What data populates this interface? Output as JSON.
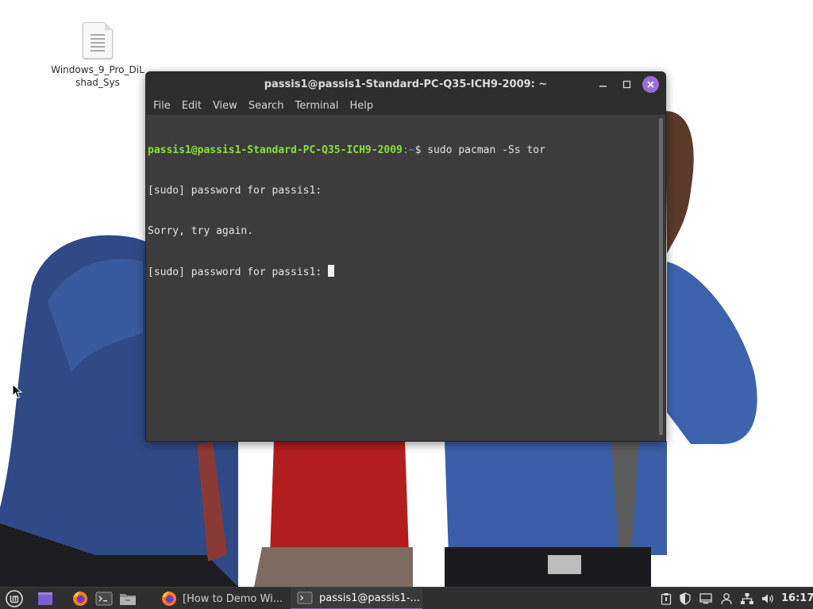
{
  "desktop": {
    "icons": [
      {
        "label": "Windows_9_Pro_DiLshad_Sys"
      }
    ]
  },
  "window": {
    "title": "passis1@passis1-Standard-PC-Q35-ICH9-2009: ~",
    "close_color": "#9b6bd9",
    "menu": [
      "File",
      "Edit",
      "View",
      "Search",
      "Terminal",
      "Help"
    ]
  },
  "terminal": {
    "prompt_user": "passis1@passis1-Standard-PC-Q35-ICH9-2009",
    "prompt_dir": ":~",
    "prompt_symbol": "$ ",
    "command": "sudo pacman -Ss tor",
    "output": [
      "[sudo] password for passis1:",
      "Sorry, try again.",
      "[sudo] password for passis1: "
    ],
    "prompt_user_color": "#8ae234",
    "prompt_dir_color": "#729fcf"
  },
  "taskbar": {
    "launchers": [
      "linux-mint-menu-icon",
      "show-desktop-icon",
      "firefox-icon",
      "terminal-icon",
      "files-icon"
    ],
    "tasks": [
      {
        "label": "[How to Demo Wi...",
        "icon": "firefox-icon",
        "active": false
      },
      {
        "label": "passis1@passis1-...",
        "icon": "terminal-icon",
        "active": true
      }
    ],
    "tray": [
      "clipboard-icon",
      "shield-icon",
      "display-icon",
      "user-icon",
      "network-icon",
      "volume-icon"
    ],
    "clock": "16:17",
    "accent": "#8f5ce0"
  }
}
